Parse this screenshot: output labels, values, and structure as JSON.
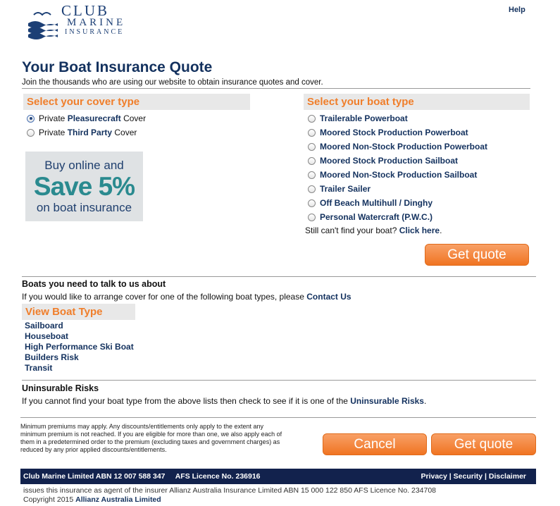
{
  "header": {
    "logo": {
      "club": "CLUB",
      "marine": "MARINE",
      "insurance": "INSURANCE"
    },
    "help_label": "Help"
  },
  "page": {
    "title": "Your Boat Insurance Quote",
    "subtitle": "Join the thousands who are using our website to obtain insurance quotes and cover."
  },
  "cover": {
    "heading": "Select your cover type",
    "options": [
      {
        "prefix": "Private ",
        "emphasis": "Pleasurecraft",
        "suffix": " Cover",
        "checked": true
      },
      {
        "prefix": "Private ",
        "emphasis": "Third Party",
        "suffix": " Cover",
        "checked": false
      }
    ]
  },
  "promo": {
    "line1": "Buy online and",
    "line2": "Save 5%",
    "line3": "on boat insurance"
  },
  "boat": {
    "heading": "Select your boat type",
    "options": [
      "Trailerable Powerboat",
      "Moored Stock Production Powerboat",
      "Moored Non-Stock Production Powerboat",
      "Moored Stock Production Sailboat",
      "Moored Non-Stock Production Sailboat",
      "Trailer Sailer",
      "Off Beach Multihull / Dinghy",
      "Personal Watercraft (P.W.C.)"
    ],
    "not_found_text": "Still can't find your boat? ",
    "not_found_link": "Click here",
    "not_found_end": "."
  },
  "get_quote_label": "Get quote",
  "talk": {
    "heading": "Boats you need to talk to us about",
    "text": "If you would like to arrange cover for one of the following boat types, please ",
    "link": "Contact Us",
    "view_heading": "View Boat Type",
    "types": [
      "Sailboard",
      "Houseboat",
      "High Performance Ski Boat",
      "Builders Risk",
      "Transit"
    ]
  },
  "uninsurable": {
    "heading": "Uninsurable Risks",
    "text": "If you cannot find your boat type from the above lists then check to see if it is one of the ",
    "link": "Uninsurable Risks",
    "end": "."
  },
  "disclaimer": "Minimum premiums may apply. Any discounts/entitlements only apply to the extent any minimum premium is not reached. If you are eligible for more than one, we also apply each of them in a predetermined order to the premium (excluding taxes and government charges) as reduced by any prior applied discounts/entitlements.",
  "cancel_label": "Cancel",
  "footer": {
    "left": "Club Marine Limited ABN 12 007 588 347     AFS Licence No. 236916",
    "privacy": "Privacy",
    "security": "Security",
    "disclaimer": "Disclaimer",
    "sep": " | "
  },
  "bottom": {
    "agent_text": "issues this insurance as agent of the insurer Allianz Australia Insurance Limited ABN 15 000 122 850 AFS Licence No. 234708",
    "copyright": "Copyright 2015 ",
    "copyright_link": "Allianz Australia Limited"
  },
  "colors": {
    "navy": "#13315e",
    "orange": "#f07e2a",
    "footer_bg": "#12224d"
  }
}
